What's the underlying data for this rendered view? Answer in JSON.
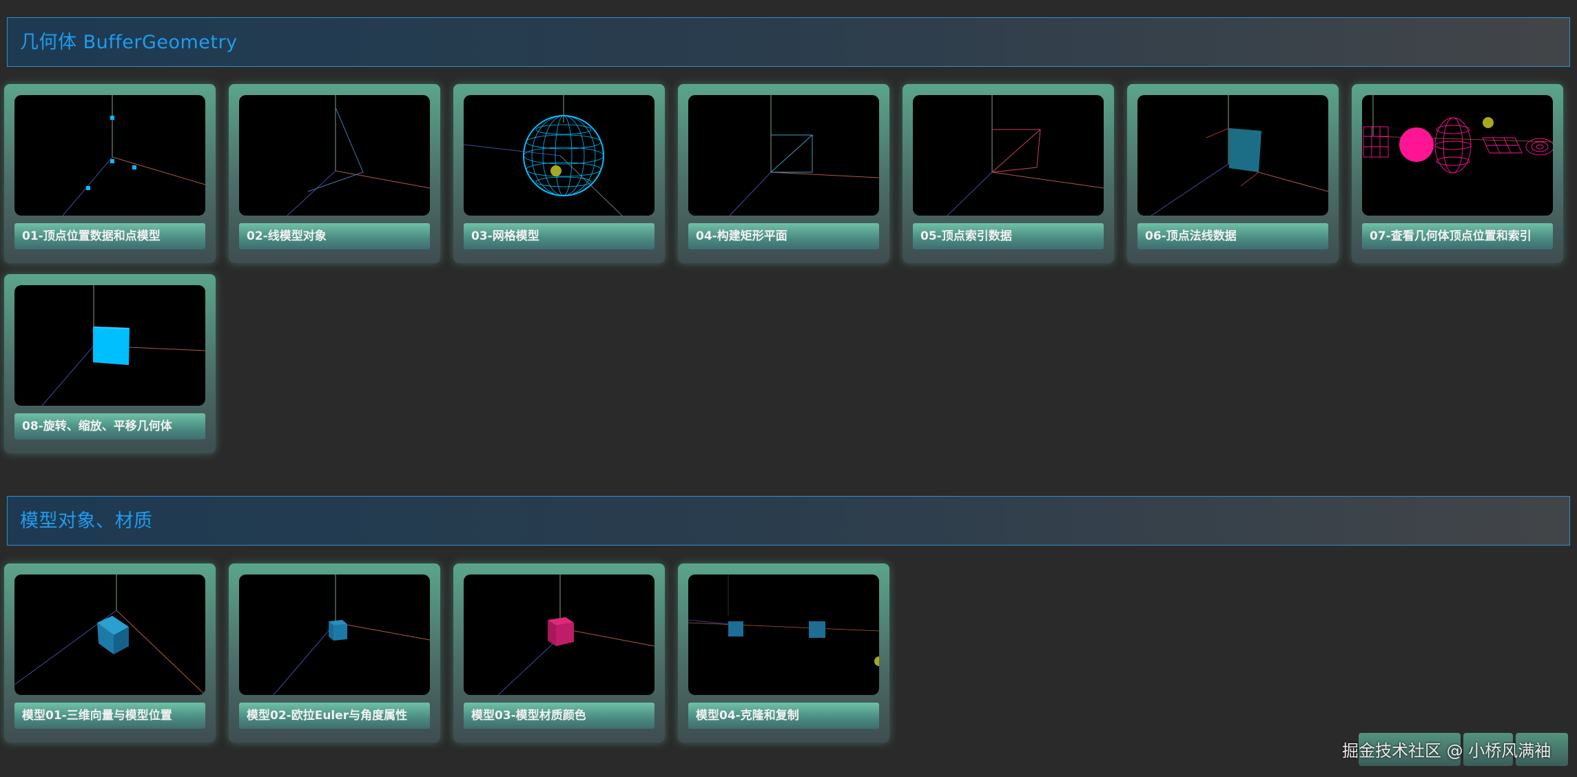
{
  "sections": [
    {
      "title": "几何体 BufferGeometry",
      "cards": [
        {
          "label": "01-顶点位置数据和点模型"
        },
        {
          "label": "02-线模型对象"
        },
        {
          "label": "03-网格模型"
        },
        {
          "label": "04-构建矩形平面"
        },
        {
          "label": "05-顶点索引数据"
        },
        {
          "label": "06-顶点法线数据"
        },
        {
          "label": "07-查看几何体顶点位置和索引"
        },
        {
          "label": "08-旋转、缩放、平移几何体"
        }
      ]
    },
    {
      "title": "模型对象、材质",
      "cards": [
        {
          "label": "模型01-三维向量与模型位置"
        },
        {
          "label": "模型02-欧拉Euler与角度属性"
        },
        {
          "label": "模型03-模型材质颜色"
        },
        {
          "label": "模型04-克隆和复制"
        }
      ]
    }
  ],
  "watermark": "掘金技术社区 @ 小桥风满袖",
  "colors": {
    "background": "#2a2a2a",
    "header_text": "#1e9cf0",
    "header_border": "#2e8ed4",
    "card_accent": "#5ba58c",
    "mesh_cyan": "#00bfff",
    "mesh_magenta": "#ff1493"
  }
}
